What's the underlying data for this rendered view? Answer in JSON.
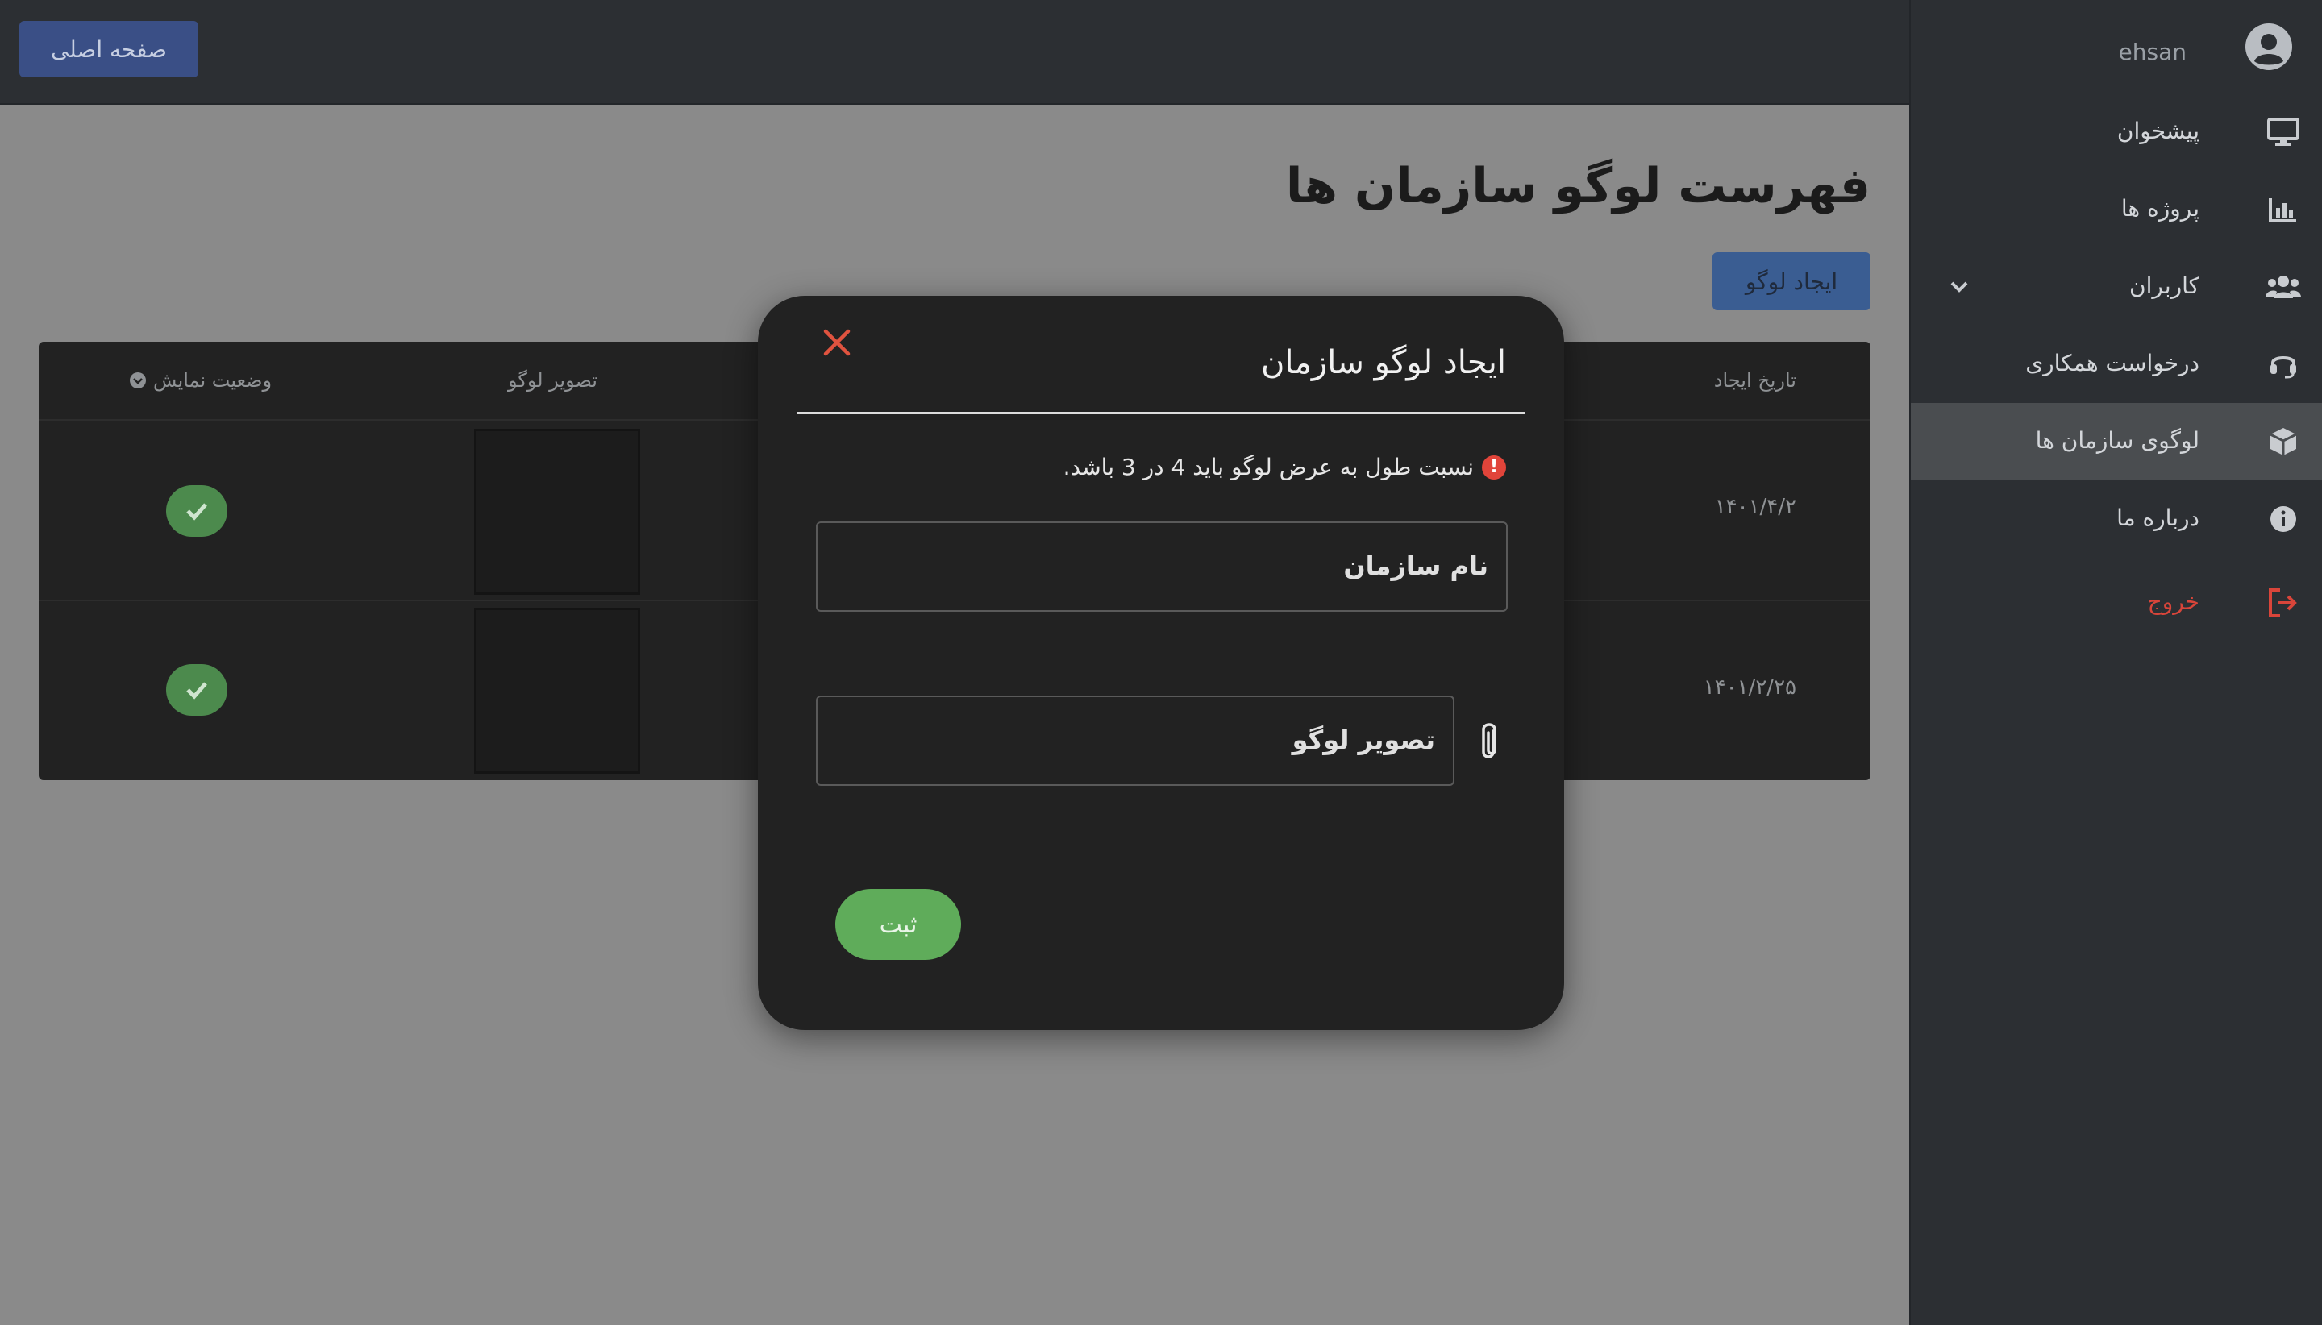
{
  "user": {
    "name": "ehsan",
    "avatar_icon": "user-circle-icon"
  },
  "topbar": {
    "home_label": "صفحه اصلی"
  },
  "sidebar": {
    "items": [
      {
        "label": "پیشخوان",
        "icon": "desktop-icon"
      },
      {
        "label": "پروژه ها",
        "icon": "chart-bar-icon"
      },
      {
        "label": "کاربران",
        "icon": "users-icon"
      },
      {
        "label": "درخواست همکاری",
        "icon": "headset-icon"
      },
      {
        "label": "لوگوی سازمان ها",
        "icon": "box-icon"
      },
      {
        "label": "درباره ما",
        "icon": "info-icon"
      },
      {
        "label": "خروج",
        "icon": "logout-icon"
      }
    ],
    "active_index": 4
  },
  "main": {
    "title": "فهرست لوگو سازمان ها",
    "create_button": "ایجاد لوگو",
    "table": {
      "headers": {
        "date": "تاریخ ایجاد",
        "logo": "تصویر لوگو",
        "status": "وضعیت نمایش"
      },
      "rows": [
        {
          "date": "۱۴۰۱/۴/۲",
          "status": "check"
        },
        {
          "date": "۱۴۰۱/۲/۲۵",
          "status": "check"
        }
      ]
    }
  },
  "modal": {
    "title": "ایجاد لوگو سازمان",
    "note": "نسبت طول به عرض لوگو باید 4 در 3 باشد.",
    "name_placeholder": "نام سازمان",
    "logo_placeholder": "تصویر لوگو",
    "submit_label": "ثبت"
  },
  "colors": {
    "sidebar_bg": "#2c2f33",
    "backdrop": "#8a8a8a",
    "modal_bg": "#222222",
    "success": "#5fac5a",
    "danger": "#d9453a",
    "primary": "#3a4f86"
  }
}
